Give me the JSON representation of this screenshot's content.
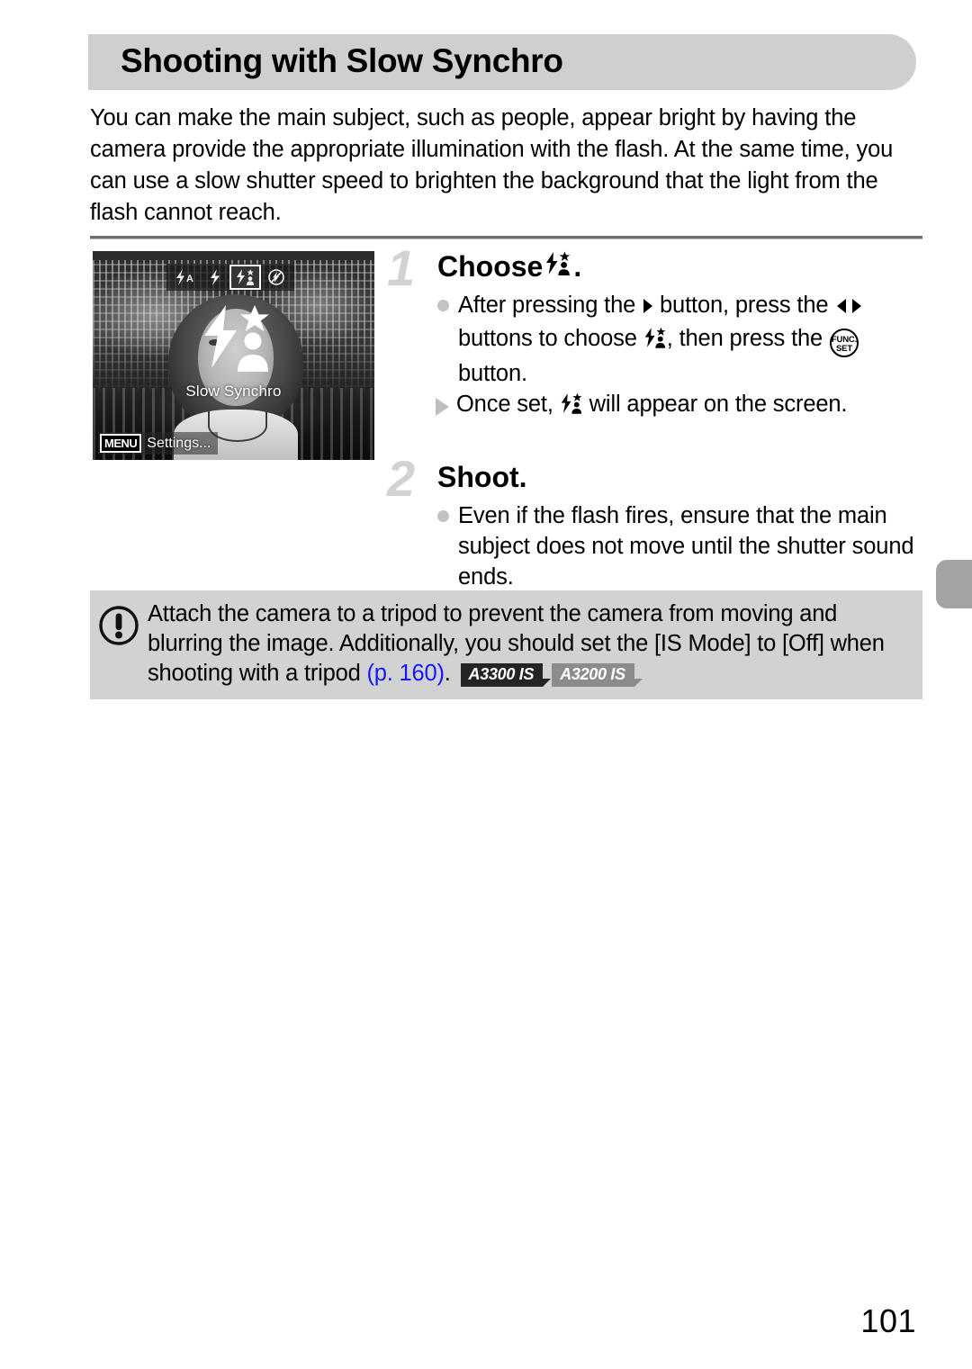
{
  "page": {
    "title": "Shooting with Slow Synchro",
    "number": "101"
  },
  "intro": {
    "paragraph": "You can make the main subject, such as people, appear bright by having the camera provide the appropriate illumination with the flash. At the same time, you can use a slow shutter speed to brighten the background that the light from the flash cannot reach."
  },
  "screenshot": {
    "mode_icons": [
      "flash-auto-icon",
      "flash-on-icon",
      "flash-slow-synchro-icon",
      "flash-off-icon"
    ],
    "selected_mode": "flash-slow-synchro-icon",
    "caption": "Slow Synchro",
    "menu_badge": "MENU",
    "menu_label": "Settings..."
  },
  "steps": [
    {
      "number": "1",
      "title_prefix": "Choose",
      "title_suffix": ".",
      "title_icon": "flash-slow-synchro-icon",
      "bullets": [
        {
          "bullet": "dot",
          "segments": [
            {
              "type": "text",
              "value": "After pressing the "
            },
            {
              "type": "icon",
              "value": "right-arrow-button-icon"
            },
            {
              "type": "text",
              "value": " button, press the "
            },
            {
              "type": "icon",
              "value": "left-right-arrow-buttons-icon"
            },
            {
              "type": "text",
              "value": " buttons to choose "
            },
            {
              "type": "icon",
              "value": "flash-slow-synchro-icon"
            },
            {
              "type": "text",
              "value": ", then press the "
            },
            {
              "type": "icon",
              "value": "func-set-button-icon"
            },
            {
              "type": "text",
              "value": " button."
            }
          ]
        },
        {
          "bullet": "triangle",
          "segments": [
            {
              "type": "text",
              "value": "Once set, "
            },
            {
              "type": "icon",
              "value": "flash-slow-synchro-icon"
            },
            {
              "type": "text",
              "value": " will appear on the screen."
            }
          ]
        }
      ]
    },
    {
      "number": "2",
      "title_prefix": "Shoot.",
      "title_suffix": "",
      "title_icon": null,
      "bullets": [
        {
          "bullet": "dot",
          "segments": [
            {
              "type": "text",
              "value": "Even if the flash fires, ensure that the main subject does not move until the shutter sound ends."
            }
          ]
        }
      ]
    }
  ],
  "note": {
    "icon": "caution-exclamation-icon",
    "text_before_link": "Attach the camera to a tripod to prevent the camera from moving and blurring the image. Additionally, you should set the [IS Mode] to [Off] when shooting with a tripod ",
    "link": "(p. 160)",
    "text_after_link": ".",
    "badges": [
      {
        "label": "A3300 IS",
        "style": "dark"
      },
      {
        "label": "A3200 IS",
        "style": "grey"
      }
    ]
  },
  "colors": {
    "header_bar": "#cfcfcf",
    "note_bg": "#d2d2d2",
    "step_number": "#d2d2d2",
    "link": "#1419ff",
    "badge_dark": "#242424",
    "badge_grey": "#8c8c8c",
    "edge_tab": "#a3a3a3"
  }
}
